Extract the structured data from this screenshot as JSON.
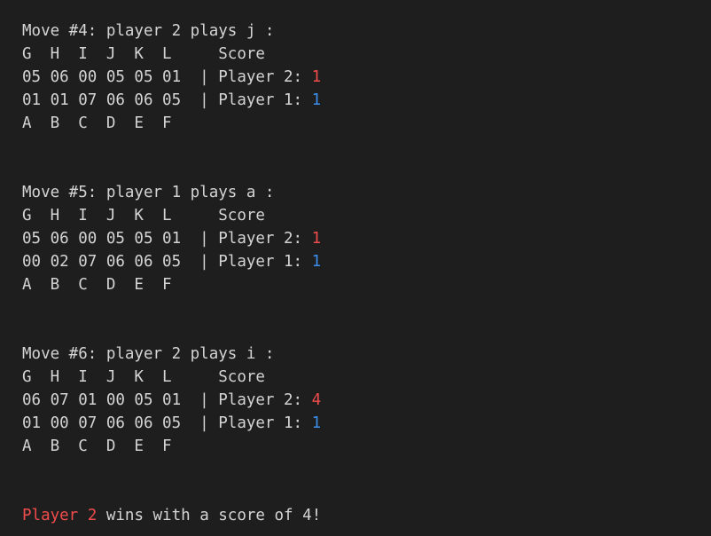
{
  "colors": {
    "background": "#1e1e1e",
    "text": "#d4d4d4",
    "player2": "#f14c4c",
    "player1": "#3b8eea"
  },
  "moves": [
    {
      "header": "Move #4: player 2 plays j :",
      "top_letters": "G  H  I  J  K  L     Score",
      "row_p2_cells": "05 06 00 05 05 01  | Player 2: ",
      "row_p2_score": "1",
      "row_p1_cells": "01 01 07 06 06 05  | Player 1: ",
      "row_p1_score": "1",
      "bottom_letters": "A  B  C  D  E  F"
    },
    {
      "header": "Move #5: player 1 plays a :",
      "top_letters": "G  H  I  J  K  L     Score",
      "row_p2_cells": "05 06 00 05 05 01  | Player 2: ",
      "row_p2_score": "1",
      "row_p1_cells": "00 02 07 06 06 05  | Player 1: ",
      "row_p1_score": "1",
      "bottom_letters": "A  B  C  D  E  F"
    },
    {
      "header": "Move #6: player 2 plays i :",
      "top_letters": "G  H  I  J  K  L     Score",
      "row_p2_cells": "06 07 01 00 05 01  | Player 2: ",
      "row_p2_score": "4",
      "row_p1_cells": "01 00 07 06 06 05  | Player 1: ",
      "row_p1_score": "1",
      "bottom_letters": "A  B  C  D  E  F"
    }
  ],
  "result": {
    "winner": "Player 2",
    "text": " wins with a score of 4!"
  }
}
